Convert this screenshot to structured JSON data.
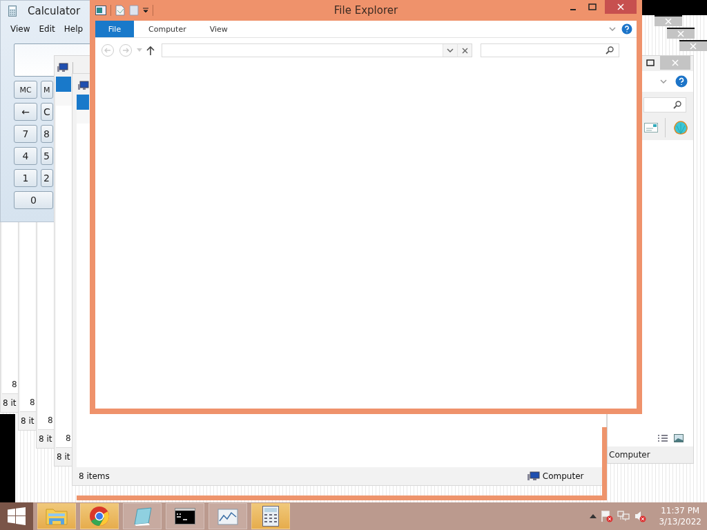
{
  "calculator": {
    "title": "Calculator",
    "menu": [
      "View",
      "Edit",
      "Help"
    ],
    "keys": [
      [
        "MC",
        "M"
      ],
      [
        "←",
        "C"
      ],
      [
        "7",
        "8"
      ],
      [
        "4",
        "5"
      ],
      [
        "1",
        "2"
      ],
      [
        "0"
      ]
    ]
  },
  "trail_windows": [
    {
      "fragment": "8",
      "status": "8 it"
    },
    {
      "fragment": "8",
      "status": "8 it"
    },
    {
      "fragment": "8",
      "status": "8 it"
    },
    {
      "fragment": "8",
      "status": "8 it"
    }
  ],
  "back_window": {
    "status": "8 items",
    "location": "Computer"
  },
  "right_window": {
    "location": "Computer"
  },
  "main_window": {
    "title": "File Explorer",
    "tabs": [
      {
        "label": "File",
        "selected": true
      },
      {
        "label": "Computer",
        "selected": false
      },
      {
        "label": "View",
        "selected": false
      }
    ]
  },
  "taskbar": {
    "apps": [
      {
        "kind": "explorer",
        "selected": true
      },
      {
        "kind": "chrome",
        "selected": true
      },
      {
        "kind": "notepad",
        "selected": false
      },
      {
        "kind": "console",
        "selected": false
      },
      {
        "kind": "monitor",
        "selected": false
      },
      {
        "kind": "calculator",
        "selected": true
      }
    ],
    "time": "11:37 PM",
    "date": "3/13/2022"
  }
}
